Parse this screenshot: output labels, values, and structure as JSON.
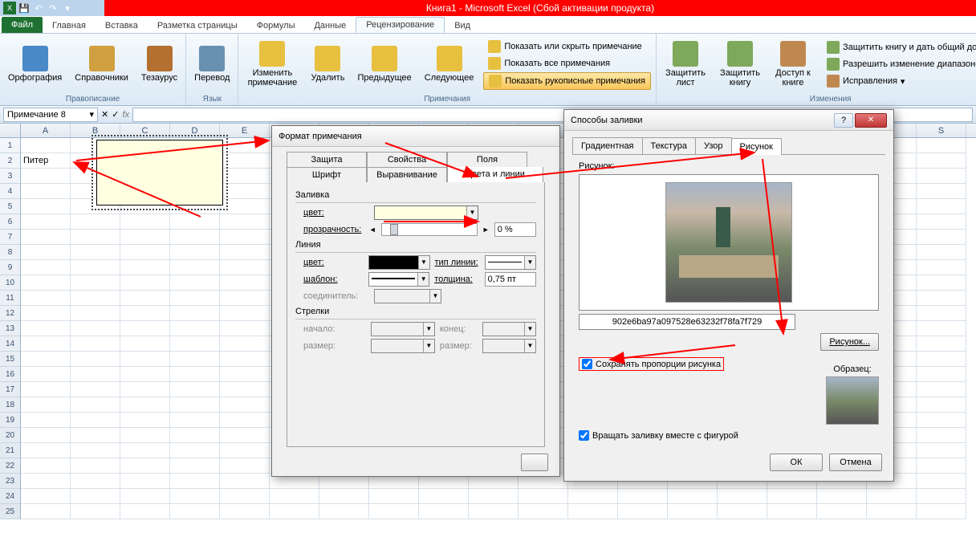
{
  "title": "Книга1 - Microsoft Excel (Сбой активации продукта)",
  "tabs": {
    "file": "Файл",
    "home": "Главная",
    "insert": "Вставка",
    "layout": "Разметка страницы",
    "formulas": "Формулы",
    "data": "Данные",
    "review": "Рецензирование",
    "view": "Вид"
  },
  "ribbon": {
    "proofing": {
      "label": "Правописание",
      "spelling": "Орфография",
      "research": "Справочники",
      "thesaurus": "Тезаурус"
    },
    "language": {
      "label": "Язык",
      "translate": "Перевод"
    },
    "comments": {
      "label": "Примечания",
      "edit": "Изменить примечание",
      "delete": "Удалить",
      "prev": "Предыдущее",
      "next": "Следующее",
      "showhide": "Показать или скрыть примечание",
      "showall": "Показать все примечания",
      "ink": "Показать рукописные примечания"
    },
    "changes": {
      "label": "Изменения",
      "protectsheet": "Защитить лист",
      "protectbook": "Защитить книгу",
      "share": "Доступ к книге",
      "shareprotect": "Защитить книгу и дать общий доступ",
      "allowranges": "Разрешить изменение диапазонов",
      "track": "Исправления"
    }
  },
  "namebox": "Примечание 8",
  "cell_a2": "Питер",
  "dlg1": {
    "title": "Формат примечания",
    "tabs": {
      "protect": "Защита",
      "props": "Свойства",
      "margins": "Поля",
      "font": "Шрифт",
      "align": "Выравнивание",
      "colors": "Цвета и линии"
    },
    "fill": "Заливка",
    "color": "цвет:",
    "transparency": "прозрачность:",
    "pct": "0 %",
    "line": "Линия",
    "linetype": "тип линии:",
    "pattern": "шаблон:",
    "weight": "толщина:",
    "weightv": "0,75 пт",
    "connector": "соединитель:",
    "arrows": "Стрелки",
    "begin": "начало:",
    "end": "конец:",
    "size": "размер:"
  },
  "dlg2": {
    "title": "Способы заливки",
    "tabs": {
      "gradient": "Градиентная",
      "texture": "Текстура",
      "pattern": "Узор",
      "picture": "Рисунок"
    },
    "piclabel": "Рисунок:",
    "filename": "902e6ba97a097528e63232f78fa7f729",
    "picbtn": "Рисунок...",
    "lockaspect": "Сохранять пропорции рисунка",
    "rotate": "Вращать заливку вместе с фигурой",
    "sample": "Образец:",
    "ok": "ОК",
    "cancel": "Отмена"
  }
}
